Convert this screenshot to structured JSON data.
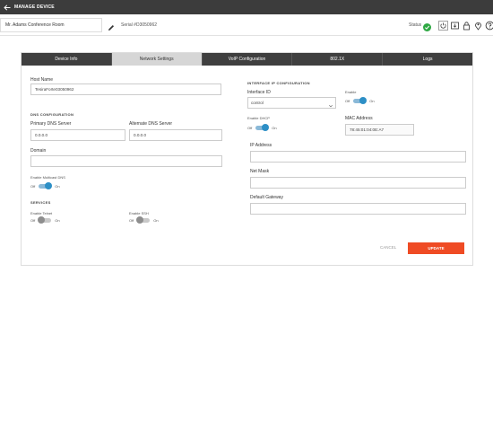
{
  "topbar": {
    "title": "MANAGE DEVICE"
  },
  "device": {
    "name": "Mr. Adams Conference Room",
    "serial": "Serial #D3050962"
  },
  "status": {
    "label": "Status"
  },
  "tabs": [
    "Device Info",
    "Network Settings",
    "VoIP Configuration",
    "802.1X",
    "Logs"
  ],
  "host": {
    "label": "Host Name",
    "value": "TesiraForte03050962"
  },
  "dns": {
    "section": "DNS CONFIGURATION",
    "primary_label": "Primary DNS Server",
    "primary_value": "0.0.0.0",
    "alternate_label": "Alternate DNS Server",
    "alternate_value": "0.0.0.0",
    "domain_label": "Domain",
    "domain_value": "",
    "multicast_label": "Enable Multicast DNS",
    "off": "Off",
    "on": "On"
  },
  "services": {
    "section": "SERVICES",
    "telnet_label": "Enable Telnet",
    "ssh_label": "Enable SSH",
    "off": "Off",
    "on": "On"
  },
  "interface": {
    "section": "INTERFACE IP CONFIGURATION",
    "id_label": "Interface ID",
    "id_value": "control",
    "enable_label": "Enable",
    "dhcp_label": "Enable DHCP",
    "mac_label": "MAC Address",
    "mac_value": "78:45:01:04:0E:A7",
    "ip_label": "IP Address",
    "ip_value": "",
    "mask_label": "Net Mask",
    "mask_value": "",
    "gateway_label": "Default Gateway",
    "gateway_value": "",
    "off": "Off",
    "on": "On"
  },
  "actions": {
    "cancel": "CANCEL",
    "update": "UPDATE"
  },
  "colors": {
    "topbar": "#3c3c3c",
    "accent": "#ef4b24",
    "toggle_on": "#2d8fc6",
    "status_ok": "#2ea843"
  }
}
